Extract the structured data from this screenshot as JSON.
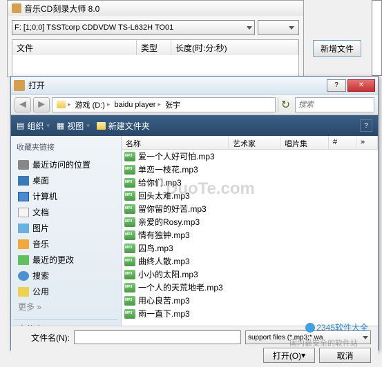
{
  "main": {
    "title": "音乐CD刻录大师 8.0",
    "device": "F: [1;0;0] TSSTcorp CDDVDW TS-L632H  TO01",
    "columns": {
      "file": "文件",
      "type": "类型",
      "length": "长度(时:分:秒)"
    },
    "new_file_btn": "新增文件"
  },
  "dialog": {
    "title": "打开",
    "breadcrumb": {
      "drive": "游戏 (D:)",
      "folder1": "baidu player",
      "folder2": "张宇"
    },
    "search_placeholder": "搜索",
    "toolbar": {
      "organize": "组织",
      "views": "视图",
      "new_folder": "新建文件夹"
    },
    "sidebar": {
      "header": "收藏夹链接",
      "items": [
        {
          "label": "最近访问的位置",
          "ico": "ico-recent"
        },
        {
          "label": "桌面",
          "ico": "ico-desktop"
        },
        {
          "label": "计算机",
          "ico": "ico-computer"
        },
        {
          "label": "文档",
          "ico": "ico-docs"
        },
        {
          "label": "图片",
          "ico": "ico-pics"
        },
        {
          "label": "音乐",
          "ico": "ico-music"
        },
        {
          "label": "最近的更改",
          "ico": "ico-changes"
        },
        {
          "label": "搜索",
          "ico": "ico-search"
        },
        {
          "label": "公用",
          "ico": "ico-public"
        }
      ],
      "more": "更多 »",
      "folders": "文件夹"
    },
    "columns": {
      "name": "名称",
      "artist": "艺术家",
      "album": "唱片集",
      "num": "#"
    },
    "files": [
      "爱一个人好可怕.mp3",
      "单恋一枝花.mp3",
      "给你们.mp3",
      "回头太难.mp3",
      "留你留的好苦.mp3",
      "亲爱的Rosy.mp3",
      "情有独钟.mp3",
      "囚鸟.mp3",
      "曲终人散.mp3",
      "小小的太阳.mp3",
      "一个人的天荒地老.mp3",
      "用心良苦.mp3",
      "雨一直下.mp3"
    ],
    "footer": {
      "filename_label": "文件名(N):",
      "filter": "support files (*.mp3;*.wa",
      "open_btn": "打开(O)",
      "cancel_btn": "取消"
    }
  },
  "watermark": "DuoTe.com",
  "brand": "2345软件大全",
  "brand_sub": "国内最安全的软件站"
}
